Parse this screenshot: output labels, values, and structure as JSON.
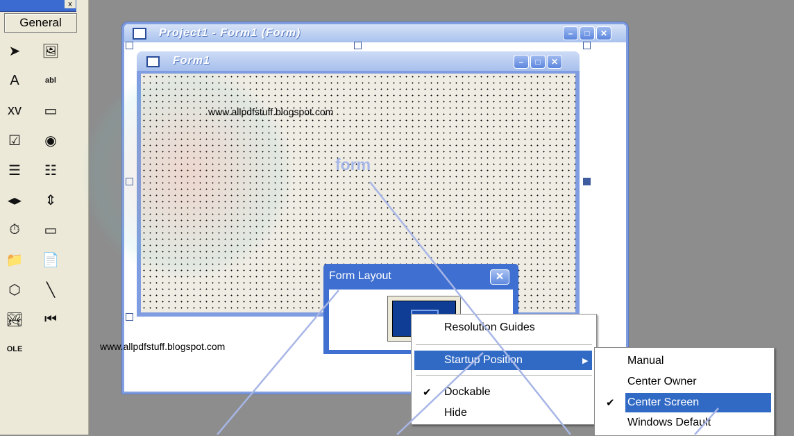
{
  "toolbox": {
    "tab_label": "General",
    "close_glyph": "x",
    "tools": [
      {
        "name": "pointer-icon",
        "glyph": "➤"
      },
      {
        "name": "picturebox-icon",
        "glyph": "🖼"
      },
      {
        "name": "label-icon",
        "glyph": "A"
      },
      {
        "name": "textbox-icon",
        "glyph": "abl"
      },
      {
        "name": "frame-icon",
        "glyph": "xv"
      },
      {
        "name": "commandbutton-icon",
        "glyph": "▭"
      },
      {
        "name": "checkbox-icon",
        "glyph": "☑"
      },
      {
        "name": "optionbutton-icon",
        "glyph": "◉"
      },
      {
        "name": "combobox-icon",
        "glyph": "☰"
      },
      {
        "name": "listbox-icon",
        "glyph": "☷"
      },
      {
        "name": "hscrollbar-icon",
        "glyph": "◂▸"
      },
      {
        "name": "vscrollbar-icon",
        "glyph": "⇕"
      },
      {
        "name": "timer-icon",
        "glyph": "⏱"
      },
      {
        "name": "drivelistbox-icon",
        "glyph": "▭"
      },
      {
        "name": "dirlistbox-icon",
        "glyph": "📁"
      },
      {
        "name": "filelistbox-icon",
        "glyph": "📄"
      },
      {
        "name": "shape-icon",
        "glyph": "⬡"
      },
      {
        "name": "line-icon",
        "glyph": "╲"
      },
      {
        "name": "image-icon",
        "glyph": "🏞"
      },
      {
        "name": "data-icon",
        "glyph": "⏮"
      },
      {
        "name": "ole-icon",
        "glyph": "OLE"
      }
    ]
  },
  "project_window": {
    "title": "Project1 - Form1 (Form)"
  },
  "form_window": {
    "title": "Form1"
  },
  "watermark_urls": {
    "top": "www.allpdfstuff.blogspot.com",
    "bottom": "www.allpdfstuff.blogspot.com"
  },
  "annotation": {
    "form_label": "form"
  },
  "form_layout": {
    "title": "Form Layout",
    "close_glyph": "✕"
  },
  "context_menu": {
    "items": [
      {
        "label": "Resolution Guides",
        "checked": false,
        "submenu": false
      },
      {
        "label": "Startup Position",
        "checked": false,
        "submenu": true,
        "highlighted": true
      },
      {
        "label": "Dockable",
        "checked": true,
        "submenu": false
      },
      {
        "label": "Hide",
        "checked": false,
        "submenu": false
      }
    ]
  },
  "submenu": {
    "items": [
      {
        "label": "Manual",
        "checked": false
      },
      {
        "label": "Center Owner",
        "checked": false
      },
      {
        "label": "Center Screen",
        "checked": true,
        "highlighted": true
      },
      {
        "label": "Windows Default",
        "checked": false
      }
    ]
  },
  "colors": {
    "desktop": "#8d8d8d",
    "title_bar_blue": "#3f6fd0",
    "menu_highlight": "#316ac5",
    "callout_line": "#a7b6e6"
  }
}
